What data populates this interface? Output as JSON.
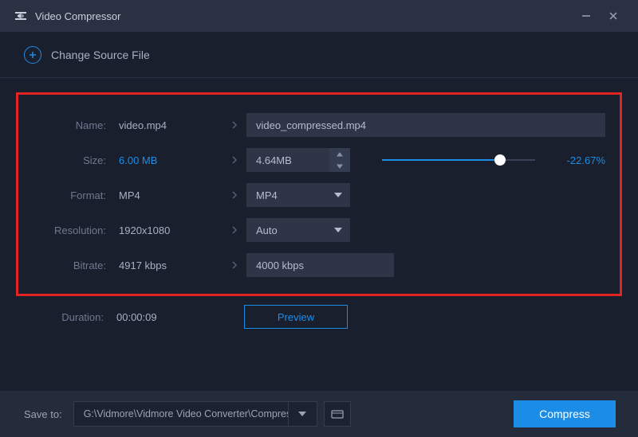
{
  "window": {
    "title": "Video Compressor"
  },
  "actions": {
    "change_source": "Change Source File",
    "preview": "Preview",
    "compress": "Compress",
    "save_to_label": "Save to:"
  },
  "labels": {
    "name": "Name:",
    "size": "Size:",
    "format": "Format:",
    "resolution": "Resolution:",
    "bitrate": "Bitrate:",
    "duration": "Duration:"
  },
  "source": {
    "name": "video.mp4",
    "size": "6.00 MB",
    "format": "MP4",
    "resolution": "1920x1080",
    "bitrate": "4917 kbps",
    "duration": "00:00:09"
  },
  "target": {
    "name": "video_compressed.mp4",
    "size": "4.64MB",
    "format": "MP4",
    "resolution": "Auto",
    "bitrate": "4000 kbps",
    "size_percent_text": "-22.67%",
    "slider_fill_percent": 77
  },
  "save": {
    "path": "G:\\Vidmore\\Vidmore Video Converter\\Compressed"
  }
}
